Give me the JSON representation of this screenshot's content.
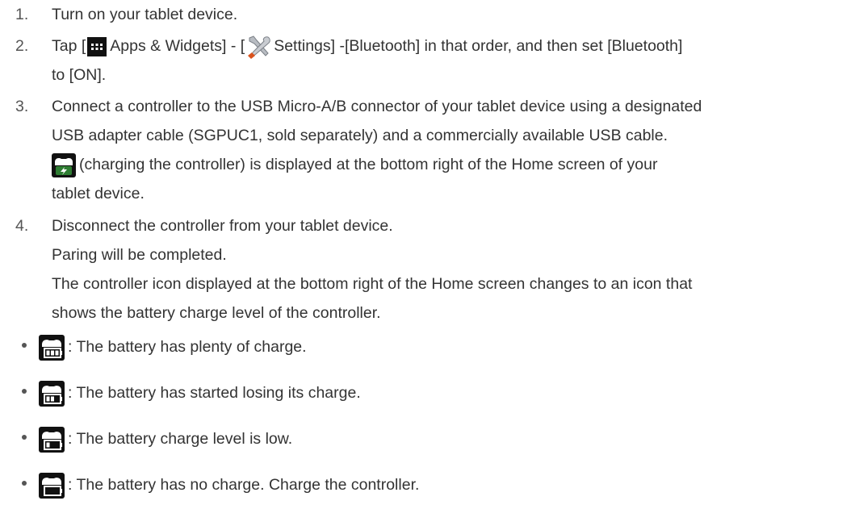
{
  "steps": [
    {
      "number": "1.",
      "text": "Turn on your tablet device."
    },
    {
      "number": "2.",
      "tap": "Tap [",
      "apps_label": "Apps & Widgets] - [",
      "settings_label": "Settings] -[Bluetooth] in that order, and then set [Bluetooth]",
      "line2": "to [ON]."
    },
    {
      "number": "3.",
      "line1": "Connect a controller to the USB Micro-A/B connector of your tablet device using a designated",
      "line2": "USB adapter cable (SGPUC1, sold separately) and a commercially available USB cable.",
      "line3": "(charging the controller) is displayed at the bottom right of the Home screen of your",
      "line4": "tablet device."
    },
    {
      "number": "4.",
      "line1": "Disconnect the controller from your tablet device.",
      "line2": "Paring will be completed.",
      "line3": "The controller icon displayed at the bottom right of the Home screen changes to an icon that",
      "line4": "shows the battery charge level of the controller."
    }
  ],
  "battery_levels": [
    {
      "text": ": The battery has plenty of charge.",
      "level": 3,
      "icon": "battery-full-icon"
    },
    {
      "text": ": The battery has started losing its charge.",
      "level": 2,
      "icon": "battery-medium-icon"
    },
    {
      "text": ": The battery charge level is low.",
      "level": 1,
      "icon": "battery-low-icon"
    },
    {
      "text": ": The battery has no charge. Charge the controller.",
      "level": 0,
      "icon": "battery-empty-icon"
    }
  ],
  "colors": {
    "text": "#333333",
    "number": "#555555",
    "icon_bg": "#111111",
    "charge_accent": "#2e7d32",
    "tool_accent": "#d9531e"
  }
}
